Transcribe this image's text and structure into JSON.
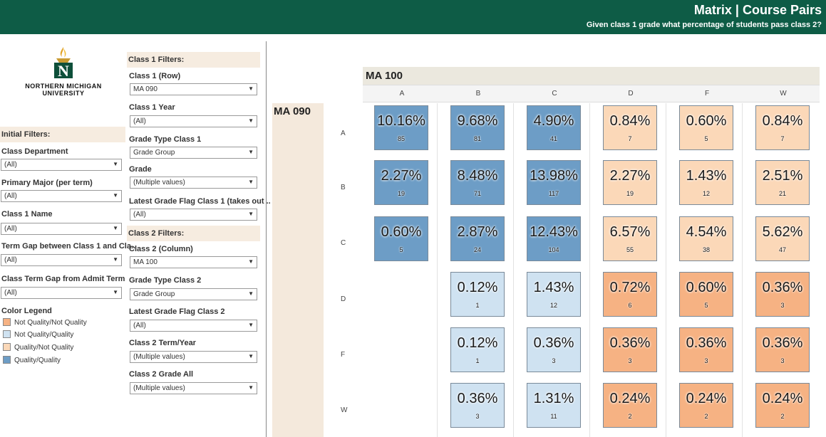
{
  "header": {
    "title": "Matrix | Course Pairs",
    "subtitle": "Given class 1 grade what percentage of students pass class 2?"
  },
  "logo": {
    "line1": "NORTHERN MICHIGAN",
    "line2": "UNIVERSITY",
    "letter": "N"
  },
  "initial_filters": {
    "heading": "Initial Filters:",
    "items": [
      {
        "label": "Class Department",
        "value": "(All)"
      },
      {
        "label": "Primary  Major  (per term)",
        "value": "(All)"
      },
      {
        "label": "Class 1 Name",
        "value": "(All)"
      },
      {
        "label": "Term Gap between Class 1 and Cla..",
        "value": "(All)"
      },
      {
        "label": "Class Term Gap from Admit Term",
        "value": "(All)"
      }
    ]
  },
  "legend": {
    "heading": "Color Legend",
    "items": [
      {
        "label": "Not Quality/Not Quality",
        "color": "#f6b283"
      },
      {
        "label": "Not Quality/Quality",
        "color": "#cfe2f1"
      },
      {
        "label": "Quality/Not Quality",
        "color": "#fbd8b8"
      },
      {
        "label": "Quality/Quality",
        "color": "#6d9dc6"
      }
    ]
  },
  "class1_filters": {
    "heading": "Class 1 Filters:",
    "items": [
      {
        "label": "Class 1 (Row)",
        "value": "MA 090"
      },
      {
        "label": "Class 1 Year",
        "value": "(All)"
      },
      {
        "label": "Grade Type Class 1",
        "value": "Grade Group"
      },
      {
        "label": "Grade",
        "value": "(Multiple values)"
      },
      {
        "label": "Latest Grade Flag Class 1 (takes out ..",
        "value": "(All)"
      }
    ]
  },
  "class2_filters": {
    "heading": "Class 2 Filters:",
    "items": [
      {
        "label": "Class 2  (Column)",
        "value": "MA 100"
      },
      {
        "label": "Grade Type Class 2",
        "value": "Grade Group"
      },
      {
        "label": "Latest Grade Flag Class 2",
        "value": "(All)"
      },
      {
        "label": "Class 2 Term/Year",
        "value": "(Multiple values)"
      },
      {
        "label": "Class 2 Grade All",
        "value": "(Multiple values)"
      }
    ]
  },
  "matrix": {
    "column_course": "MA 100",
    "row_course": "MA 090",
    "columns": [
      "A",
      "B",
      "C",
      "D",
      "F",
      "W"
    ],
    "rows": [
      "A",
      "B",
      "C",
      "D",
      "F",
      "W"
    ],
    "cells": [
      [
        {
          "pct": "10.16%",
          "n": "85",
          "type": "qq"
        },
        {
          "pct": "9.68%",
          "n": "81",
          "type": "qq"
        },
        {
          "pct": "4.90%",
          "n": "41",
          "type": "qq"
        },
        {
          "pct": "0.84%",
          "n": "7",
          "type": "qnq"
        },
        {
          "pct": "0.60%",
          "n": "5",
          "type": "qnq"
        },
        {
          "pct": "0.84%",
          "n": "7",
          "type": "qnq"
        }
      ],
      [
        {
          "pct": "2.27%",
          "n": "19",
          "type": "qq"
        },
        {
          "pct": "8.48%",
          "n": "71",
          "type": "qq"
        },
        {
          "pct": "13.98%",
          "n": "117",
          "type": "qq"
        },
        {
          "pct": "2.27%",
          "n": "19",
          "type": "qnq"
        },
        {
          "pct": "1.43%",
          "n": "12",
          "type": "qnq"
        },
        {
          "pct": "2.51%",
          "n": "21",
          "type": "qnq"
        }
      ],
      [
        {
          "pct": "0.60%",
          "n": "5",
          "type": "qq"
        },
        {
          "pct": "2.87%",
          "n": "24",
          "type": "qq"
        },
        {
          "pct": "12.43%",
          "n": "104",
          "type": "qq"
        },
        {
          "pct": "6.57%",
          "n": "55",
          "type": "qnq"
        },
        {
          "pct": "4.54%",
          "n": "38",
          "type": "qnq"
        },
        {
          "pct": "5.62%",
          "n": "47",
          "type": "qnq"
        }
      ],
      [
        null,
        {
          "pct": "0.12%",
          "n": "1",
          "type": "nqq"
        },
        {
          "pct": "1.43%",
          "n": "12",
          "type": "nqq"
        },
        {
          "pct": "0.72%",
          "n": "6",
          "type": "nqnq"
        },
        {
          "pct": "0.60%",
          "n": "5",
          "type": "nqnq"
        },
        {
          "pct": "0.36%",
          "n": "3",
          "type": "nqnq"
        }
      ],
      [
        null,
        {
          "pct": "0.12%",
          "n": "1",
          "type": "nqq"
        },
        {
          "pct": "0.36%",
          "n": "3",
          "type": "nqq"
        },
        {
          "pct": "0.36%",
          "n": "3",
          "type": "nqnq"
        },
        {
          "pct": "0.36%",
          "n": "3",
          "type": "nqnq"
        },
        {
          "pct": "0.36%",
          "n": "3",
          "type": "nqnq"
        }
      ],
      [
        null,
        {
          "pct": "0.36%",
          "n": "3",
          "type": "nqq"
        },
        {
          "pct": "1.31%",
          "n": "11",
          "type": "nqq"
        },
        {
          "pct": "0.24%",
          "n": "2",
          "type": "nqnq"
        },
        {
          "pct": "0.24%",
          "n": "2",
          "type": "nqnq"
        },
        {
          "pct": "0.24%",
          "n": "2",
          "type": "nqnq"
        }
      ]
    ]
  }
}
